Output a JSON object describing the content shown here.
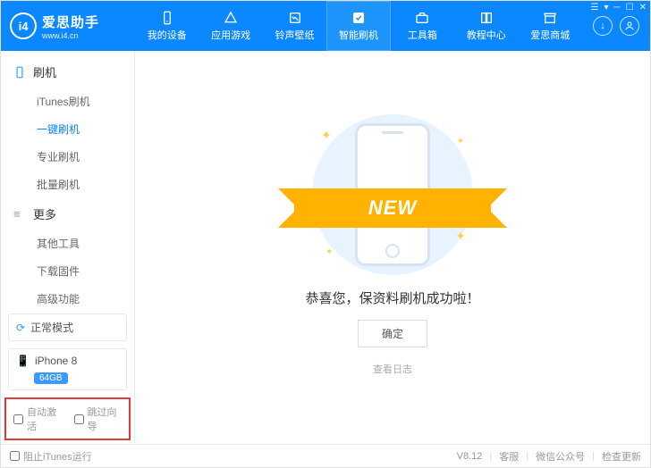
{
  "logo": {
    "badge": "i4",
    "title": "爱思助手",
    "url": "www.i4.cn"
  },
  "nav": {
    "items": [
      {
        "label": "我的设备"
      },
      {
        "label": "应用游戏"
      },
      {
        "label": "铃声壁纸"
      },
      {
        "label": "智能刷机"
      },
      {
        "label": "工具箱"
      },
      {
        "label": "教程中心"
      },
      {
        "label": "爱思商城"
      }
    ],
    "activeIndex": 3
  },
  "sidebar": {
    "section1": {
      "title": "刷机"
    },
    "items1": [
      {
        "label": "iTunes刷机"
      },
      {
        "label": "一键刷机"
      },
      {
        "label": "专业刷机"
      },
      {
        "label": "批量刷机"
      }
    ],
    "section2": {
      "title": "更多"
    },
    "items2": [
      {
        "label": "其他工具"
      },
      {
        "label": "下载固件"
      },
      {
        "label": "高级功能"
      }
    ],
    "mode": {
      "label": "正常模式"
    },
    "device": {
      "name": "iPhone 8",
      "storage": "64GB"
    },
    "checks": {
      "autoActivate": "自动激活",
      "skipGuide": "跳过向导"
    }
  },
  "main": {
    "ribbon": "NEW",
    "successText": "恭喜您，保资料刷机成功啦！",
    "okButton": "确定",
    "viewLog": "查看日志"
  },
  "footer": {
    "blockItunes": "阻止iTunes运行",
    "version": "V8.12",
    "support": "客服",
    "wechat": "微信公众号",
    "update": "检查更新"
  }
}
